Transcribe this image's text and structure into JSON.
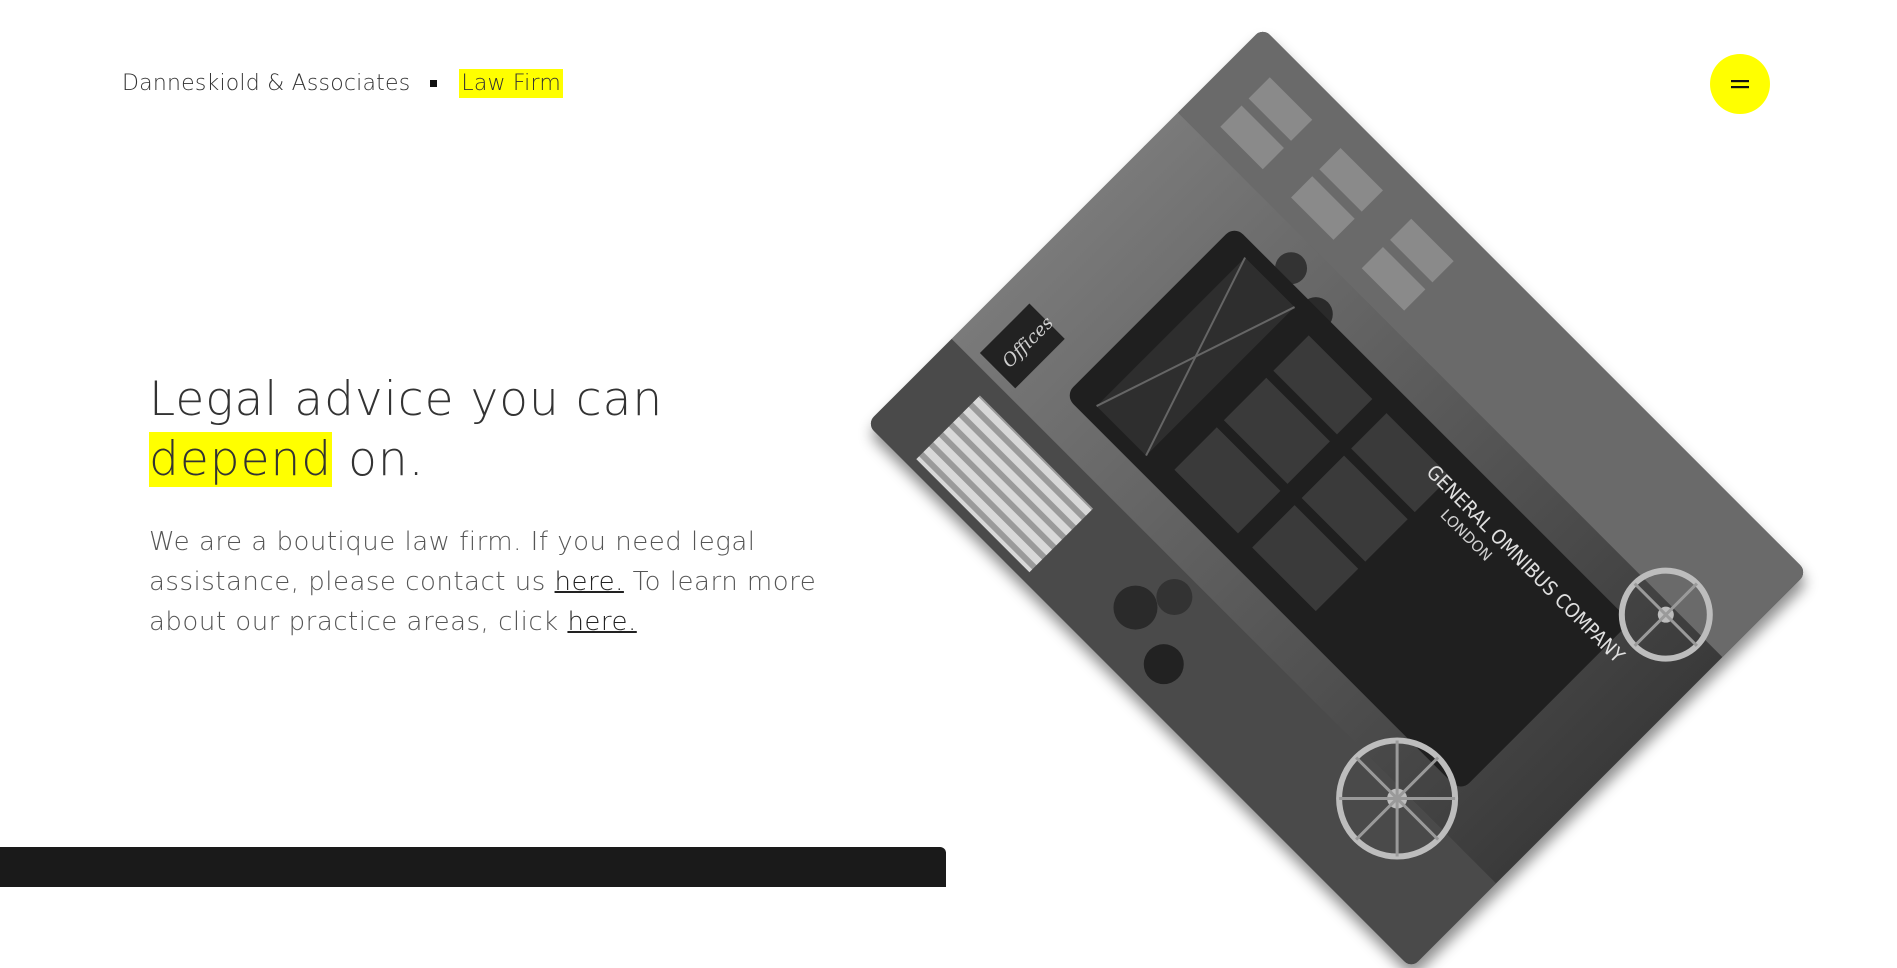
{
  "header": {
    "brand_name": "Danneskiold & Associates",
    "brand_tag": "Law Firm",
    "menu_icon": "hamburger-menu-icon",
    "accent_color": "#ffff00"
  },
  "hero": {
    "headline_part1": "Legal advice you can",
    "headline_highlight": "depend",
    "headline_part2": " on.",
    "intro_text1": "We are a boutique law firm. If you need legal assistance, please contact us ",
    "contact_link": "here.",
    "intro_text2": " To learn more about our practice areas, click ",
    "practice_link": "here."
  },
  "photo": {
    "sign_text": "GENERAL OMNIBUS COMPANY",
    "sign_top": "LONDON",
    "shop_text": "Offices"
  }
}
